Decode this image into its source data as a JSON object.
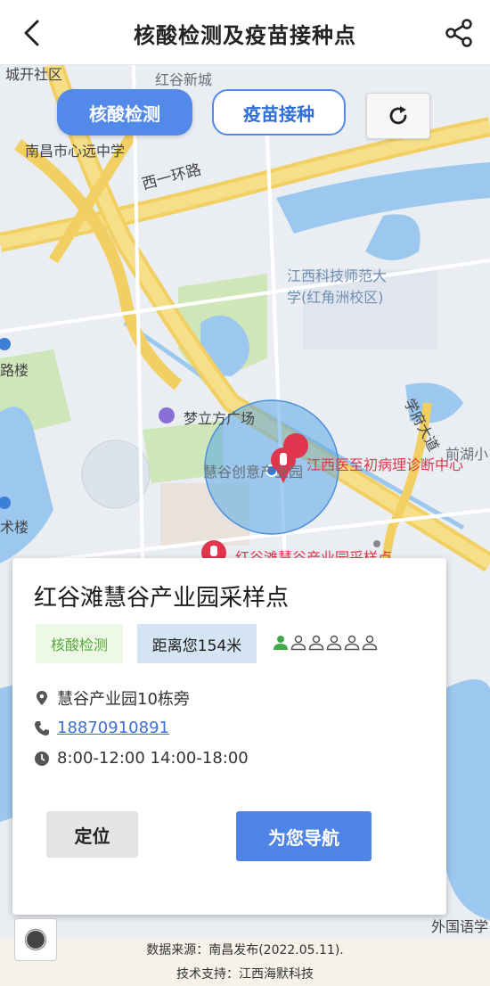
{
  "header": {
    "title": "核酸检测及疫苗接种点",
    "back_icon": "chevron-left-icon",
    "share_icon": "share-icon"
  },
  "tabs": {
    "active": "核酸检测",
    "inactive": "疫苗接种",
    "accent": "#5389e8"
  },
  "map": {
    "labels": {
      "district": "城开社区",
      "hongguxincheng": "红谷新城",
      "school": "南昌市心远中学",
      "road1": "西一环路",
      "univ_line1": "江西科技师范大",
      "univ_line2": "学(红角洲校区)",
      "building1": "路楼",
      "mall": "梦立方广场",
      "park": "慧谷创意产业园",
      "clinic": "江西医至初病理诊断中心",
      "road2": "学府大道",
      "qianhu": "前湖小",
      "building2": "术楼",
      "site_partial": "红谷滩慧谷产业园采样点",
      "school2": "外国语学"
    },
    "circle_color": "#5aa8e8",
    "marker_color": "#e0354d"
  },
  "card": {
    "site_name": "红谷滩慧谷产业园采样点",
    "type_tag": "核酸检测",
    "distance": "距离您154米",
    "crowd_level": 1,
    "crowd_max": 6,
    "address": "慧谷产业园10栋旁",
    "phone": "18870910891",
    "hours": "8:00-12:00 14:00-18:00",
    "locate_label": "定位",
    "navigate_label": "为您导航"
  },
  "footer": {
    "source": "数据来源：南昌发布(2022.05.11).",
    "support": "技术支持：江西海默科技"
  }
}
